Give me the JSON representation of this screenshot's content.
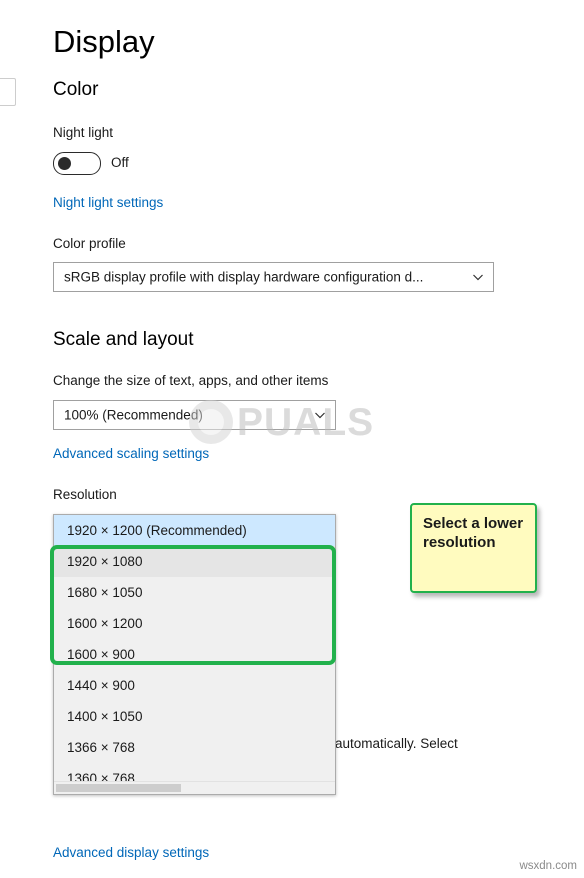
{
  "window": {
    "title": "Display"
  },
  "sections": {
    "color": "Color",
    "scale_and_layout": "Scale and layout"
  },
  "night_light": {
    "label": "Night light",
    "state": "Off",
    "settings_link": "Night light settings"
  },
  "color_profile": {
    "label": "Color profile",
    "value": "sRGB display profile with display hardware configuration d..."
  },
  "scale": {
    "label": "Change the size of text, apps, and other items",
    "value": "100% (Recommended)",
    "advanced_link": "Advanced scaling settings"
  },
  "resolution": {
    "label": "Resolution",
    "options": [
      {
        "text": "1920 × 1200 (Recommended)",
        "state": "selected"
      },
      {
        "text": "1920 × 1080",
        "state": "hover"
      },
      {
        "text": "1680 × 1050",
        "state": "normal"
      },
      {
        "text": "1600 × 1200",
        "state": "normal"
      },
      {
        "text": "1600 × 900",
        "state": "normal"
      },
      {
        "text": "1440 × 900",
        "state": "normal"
      },
      {
        "text": "1400 × 1050",
        "state": "normal"
      },
      {
        "text": "1366 × 768",
        "state": "normal"
      },
      {
        "text": "1360 × 768",
        "state": "normal"
      }
    ]
  },
  "callout": {
    "text": "Select a lower resolution"
  },
  "obscured_text": {
    "orientation_hint": "automatically. Select"
  },
  "advanced_display_link": "Advanced display settings",
  "watermark": {
    "text": "PUALS"
  },
  "footer": {
    "source": "wsxdn.com"
  },
  "colors": {
    "accent_link": "#0067b8",
    "highlight_green": "#22b14c",
    "callout_bg": "#fffbbf",
    "selected_row": "#cde8ff"
  }
}
